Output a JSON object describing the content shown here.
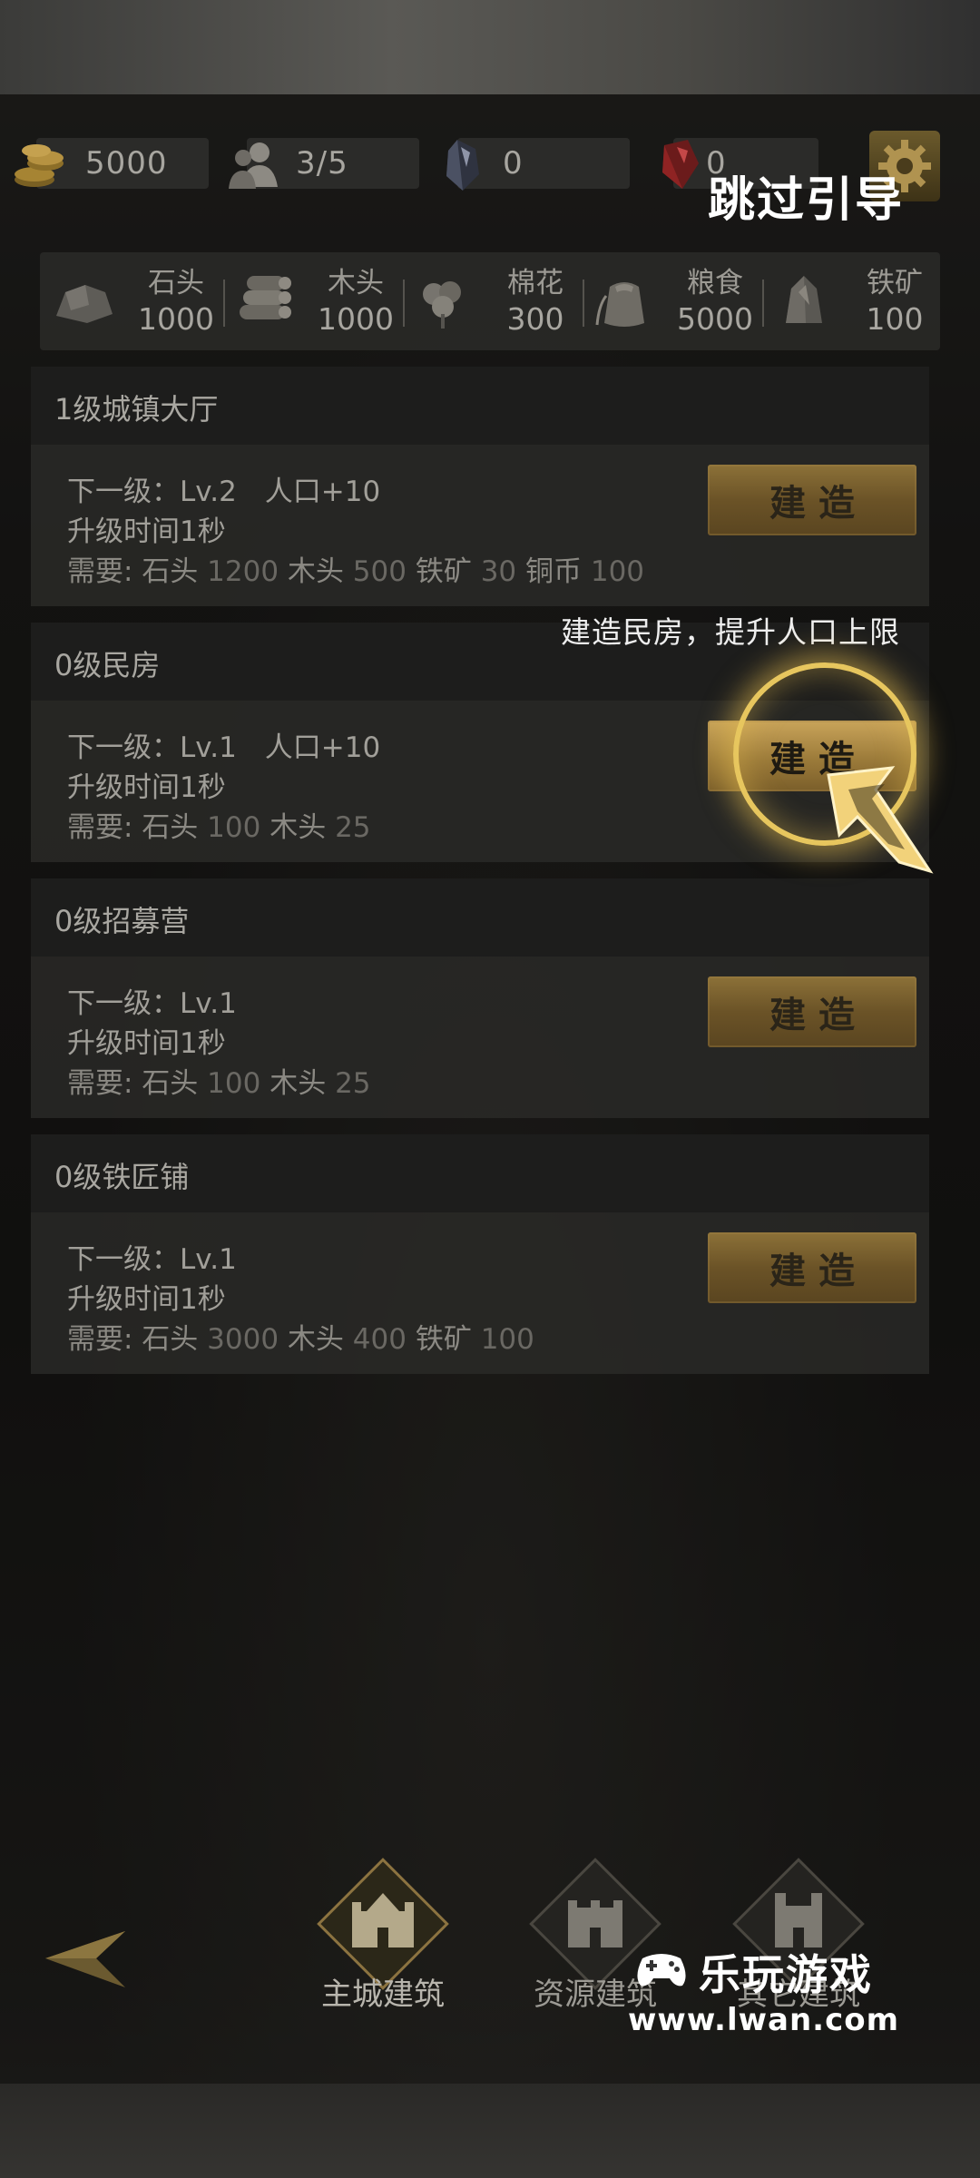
{
  "currency": {
    "gold": "5000",
    "population": "3/5",
    "crystal": "0",
    "ruby": "0"
  },
  "skip_guide": "跳过引导",
  "resources": [
    {
      "name": "石头",
      "amount": "1000",
      "icon": "stone-icon"
    },
    {
      "name": "木头",
      "amount": "1000",
      "icon": "wood-icon"
    },
    {
      "name": "棉花",
      "amount": "300",
      "icon": "cotton-icon"
    },
    {
      "name": "粮食",
      "amount": "5000",
      "icon": "grain-icon"
    },
    {
      "name": "铁矿",
      "amount": "100",
      "icon": "iron-ore-icon"
    }
  ],
  "buildings": [
    {
      "title": "1级城镇大厅",
      "next": "下一级：Lv.2　人口+10",
      "time": "升级时间1秒",
      "req_label": "需要:",
      "req": [
        [
          "石头",
          "1200"
        ],
        [
          "木头",
          "500"
        ],
        [
          "铁矿",
          "30"
        ],
        [
          "铜币",
          "100"
        ]
      ],
      "button": "建造"
    },
    {
      "title": "0级民房",
      "next": "下一级：Lv.1　人口+10",
      "time": "升级时间1秒",
      "req_label": "需要:",
      "req": [
        [
          "石头",
          "100"
        ],
        [
          "木头",
          "25"
        ]
      ],
      "button": "建造"
    },
    {
      "title": "0级招募营",
      "next": "下一级：Lv.1",
      "time": "升级时间1秒",
      "req_label": "需要:",
      "req": [
        [
          "石头",
          "100"
        ],
        [
          "木头",
          "25"
        ]
      ],
      "button": "建造"
    },
    {
      "title": "0级铁匠铺",
      "next": "下一级：Lv.1",
      "time": "升级时间1秒",
      "req_label": "需要:",
      "req": [
        [
          "石头",
          "3000"
        ],
        [
          "木头",
          "400"
        ],
        [
          "铁矿",
          "100"
        ]
      ],
      "button": "建造"
    }
  ],
  "guide_tooltip": "建造民房，提升人口上限",
  "nav": {
    "tabs": [
      "主城建筑",
      "资源建筑",
      "其它建筑"
    ],
    "active": "主城建筑"
  },
  "watermark": {
    "line1": "乐玩游戏",
    "line2": "www.lwan.com"
  },
  "colors": {
    "accent_gold": "#8c7138",
    "highlight_ring": "#e7c65e"
  }
}
